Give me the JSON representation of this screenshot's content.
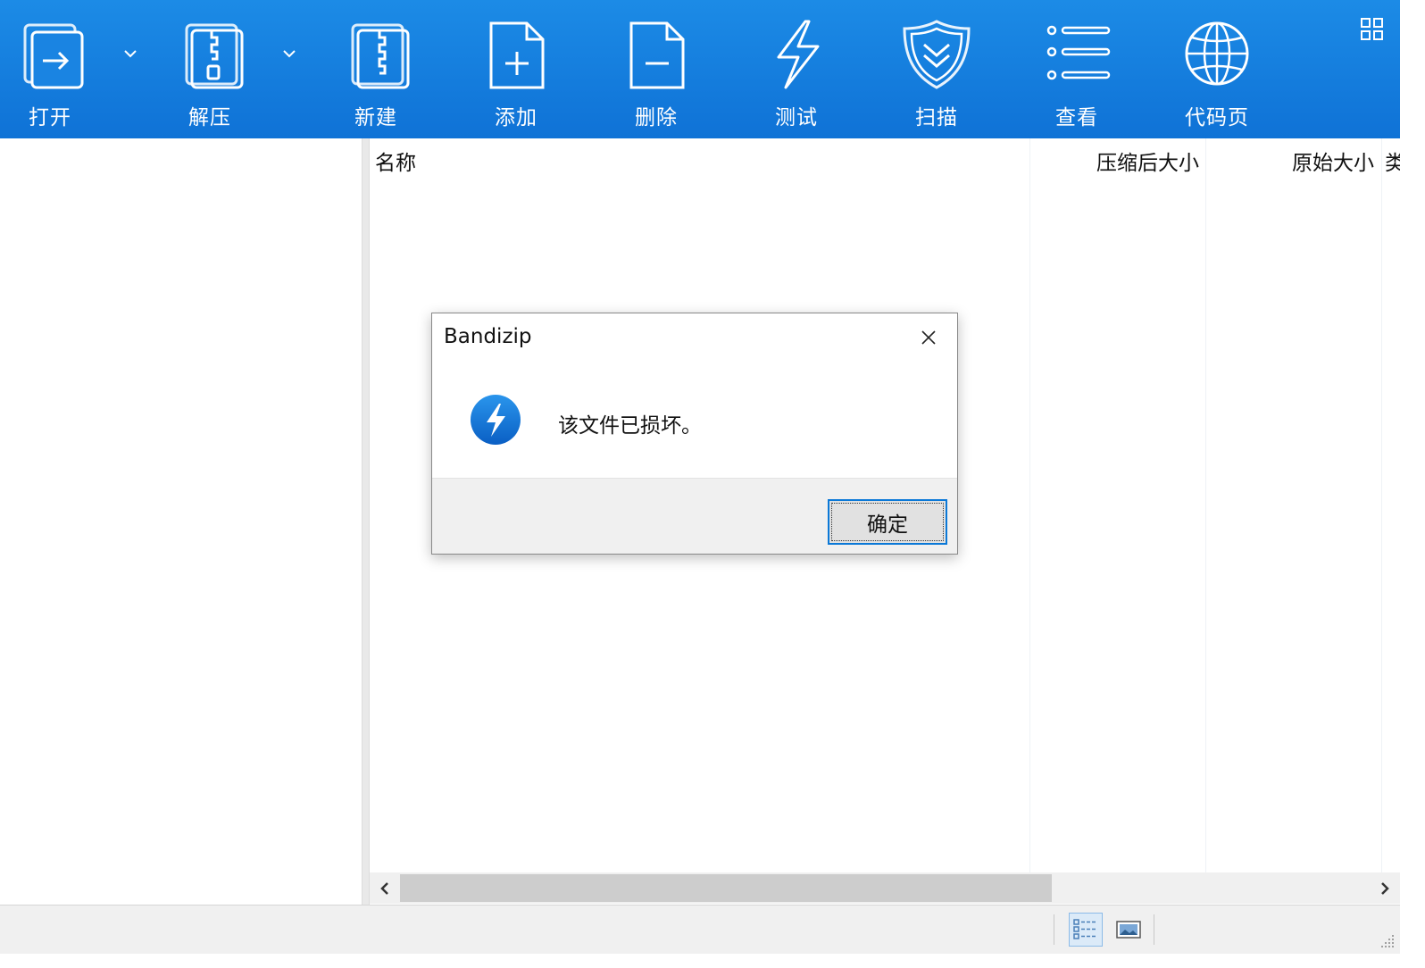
{
  "toolbar": {
    "buttons": [
      {
        "label": "打开",
        "icon": "open-icon"
      },
      {
        "label": "解压",
        "icon": "extract-icon"
      },
      {
        "label": "新建",
        "icon": "new-archive-icon"
      },
      {
        "label": "添加",
        "icon": "add-file-icon"
      },
      {
        "label": "删除",
        "icon": "delete-file-icon"
      },
      {
        "label": "测试",
        "icon": "test-lightning-icon"
      },
      {
        "label": "扫描",
        "icon": "scan-shield-icon"
      },
      {
        "label": "查看",
        "icon": "view-list-icon"
      },
      {
        "label": "代码页",
        "icon": "codepage-globe-icon"
      }
    ],
    "menu_icon": "grid-menu-icon"
  },
  "file_list": {
    "columns": [
      "名称",
      "压缩后大小",
      "原始大小",
      "类"
    ]
  },
  "dialog": {
    "title": "Bandizip",
    "message": "该文件已损坏。",
    "ok_label": "确定",
    "icon": "bandizip-logo-icon"
  },
  "statusbar": {
    "view_buttons": [
      "details-view-icon",
      "thumbnail-view-icon"
    ]
  },
  "colors": {
    "toolbar_bg": "#0f72d6",
    "accent": "#0a78d7"
  }
}
